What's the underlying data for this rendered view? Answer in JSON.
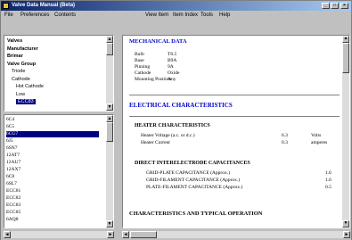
{
  "window": {
    "title": "Valve Data Manual (Beta)"
  },
  "menu": [
    "File",
    "Preferences",
    "Contents",
    "View Item",
    "Item Index",
    "Tools",
    "Help"
  ],
  "tree": {
    "items": [
      {
        "label": "Valves",
        "level": 0
      },
      {
        "label": "Manufacturer",
        "level": 0
      },
      {
        "label": "Brimar",
        "level": 0
      },
      {
        "label": "Valve Group",
        "level": 0
      },
      {
        "label": "Triode",
        "level": 1
      },
      {
        "label": "Cathode",
        "level": 1
      },
      {
        "label": "Hot Cathode",
        "level": 2
      },
      {
        "label": "Low",
        "level": 2
      },
      {
        "label": "ECC83",
        "level": 2,
        "selected": true
      }
    ]
  },
  "list": {
    "items": [
      "6C4",
      "6C5",
      "6CG7",
      "6J5",
      "6SN7",
      "12AT7",
      "12AU7",
      "12AX7",
      "6C8",
      "6SL7",
      "ECC81",
      "ECC82",
      "ECC83",
      "ECC85",
      "6AQ8"
    ],
    "selected_index": 2
  },
  "content": {
    "mechanical_heading": "MECHANICAL DATA",
    "mechanical": [
      {
        "label": "Bulb",
        "value": "T6.5"
      },
      {
        "label": "Base",
        "value": "B9A"
      },
      {
        "label": "Pinning",
        "value": "9A"
      },
      {
        "label": "Cathode",
        "value": "Oxide"
      },
      {
        "label": "Mounting Position",
        "value": "Any"
      }
    ],
    "electrical_heading": "ELECTRICAL CHARACTERISTICS",
    "heater_heading": "HEATER CHARACTERISTICS",
    "heater": [
      {
        "label": "Heater Voltage (a.c. or d.c.)",
        "value": "6.3",
        "unit": "Volts"
      },
      {
        "label": "Heater Current",
        "value": "0.3",
        "unit": "amperes"
      }
    ],
    "capacitance_heading": "DIRECT INTERELECTRODE CAPACITANCES",
    "capacitance": [
      {
        "label": "GRID-PLATE CAPACITANCE (Approx.)",
        "value": "1.6"
      },
      {
        "label": "GRID-FILAMENT CAPACITANCE (Approx.)",
        "value": "1.6"
      },
      {
        "label": "PLATE-FILAMENT CAPACITANCE (Approx.)",
        "value": "0.5"
      }
    ],
    "typical_heading": "CHARACTERISTICS AND TYPICAL OPERATION"
  }
}
